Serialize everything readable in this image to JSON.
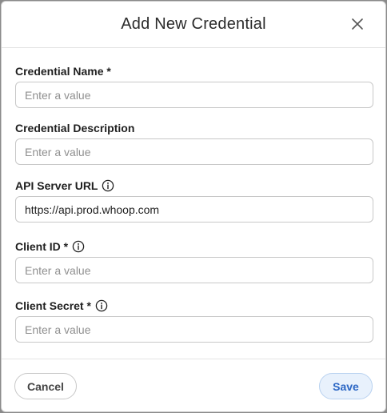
{
  "dialog": {
    "title": "Add New Credential"
  },
  "fields": [
    {
      "label": "Credential Name *",
      "value": "",
      "placeholder": "Enter a value",
      "info": false
    },
    {
      "label": "Credential Description",
      "value": "",
      "placeholder": "Enter a value",
      "info": false
    },
    {
      "label": "API Server URL",
      "value": "https://api.prod.whoop.com",
      "placeholder": "",
      "info": true
    },
    {
      "label": "Client ID *",
      "value": "",
      "placeholder": "Enter a value",
      "info": true
    },
    {
      "label": "Client Secret *",
      "value": "",
      "placeholder": "Enter a value",
      "info": true
    }
  ],
  "footer": {
    "cancel_label": "Cancel",
    "save_label": "Save"
  },
  "icons": {
    "close": "close-icon",
    "info": "info-circle-icon"
  },
  "colors": {
    "save_text": "#2b66c4",
    "save_bg": "#e8f1fc",
    "overlay": "#8a8a8a"
  }
}
